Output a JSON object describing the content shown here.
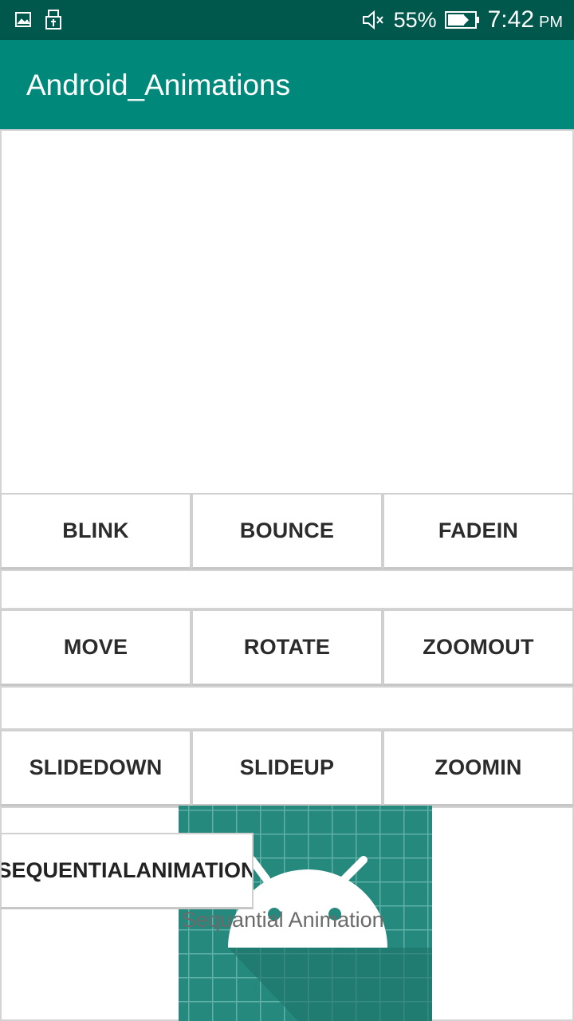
{
  "status_bar": {
    "battery_percent": "55%",
    "time": "7:42",
    "ampm": "PM",
    "icons": [
      "image-icon",
      "usb-icon",
      "mute-icon",
      "battery-icon"
    ]
  },
  "app_bar": {
    "title": "Android_Animations",
    "color": "#00897b"
  },
  "buttons": {
    "blink": "BLINK",
    "bounce": "BOUNCE",
    "fadein": "FADEIN",
    "move": "MOVE",
    "rotate": "ROTATE",
    "zoomout": "ZOOMOUT",
    "slidedown": "SLIDEDOWN",
    "slideup": "SLIDEUP",
    "zoomin": "ZOOMIN",
    "sequential": "SEQUENTIALANIMATION"
  },
  "sequential_label": "Sequantial Animation",
  "colors": {
    "status_bar": "#00574b",
    "accent": "#00897b",
    "image_bg": "#26897e"
  }
}
